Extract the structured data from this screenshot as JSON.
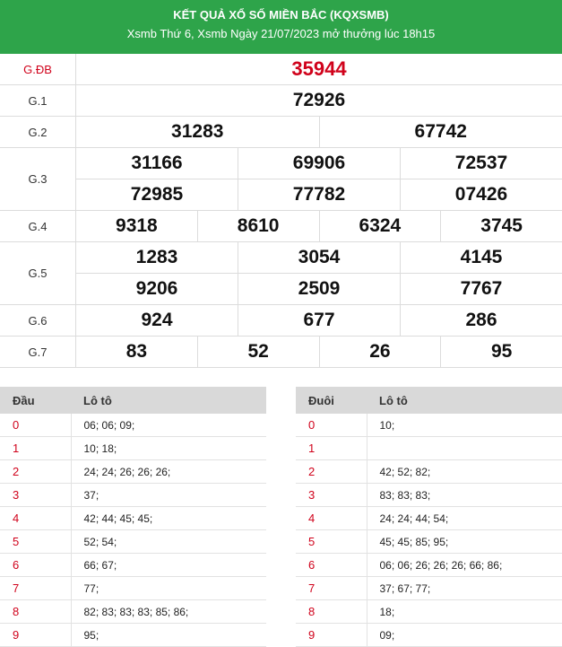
{
  "header": {
    "title": "KẾT QUẢ XỔ SỐ MIỀN BẮC (KQXSMB)",
    "subtitle": "Xsmb Thứ 6, Xsmb Ngày 21/07/2023 mở thưởng lúc 18h15"
  },
  "prizes": {
    "db": {
      "label": "G.ĐB",
      "numbers": [
        "35944"
      ]
    },
    "g1": {
      "label": "G.1",
      "numbers": [
        "72926"
      ]
    },
    "g2": {
      "label": "G.2",
      "numbers": [
        "31283",
        "67742"
      ]
    },
    "g3": {
      "label": "G.3",
      "numbers": [
        "31166",
        "69906",
        "72537",
        "72985",
        "77782",
        "07426"
      ]
    },
    "g4": {
      "label": "G.4",
      "numbers": [
        "9318",
        "8610",
        "6324",
        "3745"
      ]
    },
    "g5": {
      "label": "G.5",
      "numbers": [
        "1283",
        "3054",
        "4145",
        "9206",
        "2509",
        "7767"
      ]
    },
    "g6": {
      "label": "G.6",
      "numbers": [
        "924",
        "677",
        "286"
      ]
    },
    "g7": {
      "label": "G.7",
      "numbers": [
        "83",
        "52",
        "26",
        "95"
      ]
    }
  },
  "dau": {
    "col1": "Đầu",
    "col2": "Lô tô",
    "rows": [
      {
        "k": "0",
        "v": "06; 06; 09;"
      },
      {
        "k": "1",
        "v": "10; 18;"
      },
      {
        "k": "2",
        "v": "24; 24; 26; 26; 26;"
      },
      {
        "k": "3",
        "v": "37;"
      },
      {
        "k": "4",
        "v": "42; 44; 45; 45;"
      },
      {
        "k": "5",
        "v": "52; 54;"
      },
      {
        "k": "6",
        "v": "66; 67;"
      },
      {
        "k": "7",
        "v": "77;"
      },
      {
        "k": "8",
        "v": "82; 83; 83; 83; 85; 86;"
      },
      {
        "k": "9",
        "v": "95;"
      }
    ]
  },
  "duoi": {
    "col1": "Đuôi",
    "col2": "Lô tô",
    "rows": [
      {
        "k": "0",
        "v": "10;"
      },
      {
        "k": "1",
        "v": ""
      },
      {
        "k": "2",
        "v": "42; 52; 82;"
      },
      {
        "k": "3",
        "v": "83; 83; 83;"
      },
      {
        "k": "4",
        "v": "24; 24; 44; 54;"
      },
      {
        "k": "5",
        "v": "45; 45; 85; 95;"
      },
      {
        "k": "6",
        "v": "06; 06; 26; 26; 26; 66; 86;"
      },
      {
        "k": "7",
        "v": "37; 67; 77;"
      },
      {
        "k": "8",
        "v": "18;"
      },
      {
        "k": "9",
        "v": "09;"
      }
    ]
  },
  "colors": {
    "header_bg": "#2ea44a",
    "special": "#d0021b"
  }
}
